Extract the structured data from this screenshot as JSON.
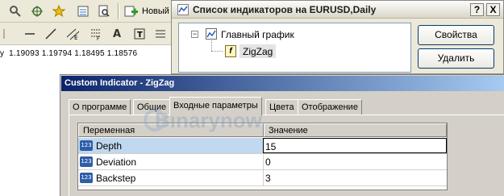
{
  "toolbar": {
    "new_order_label": "Новый о",
    "icons": [
      "magnifier-icon",
      "crosshair-icon",
      "star-icon",
      "new-chart-icon",
      "zoom-icon",
      "new-order-icon",
      "line-icon",
      "trendline-icon",
      "fibonacci-icon",
      "text-icon",
      "text-label-icon"
    ]
  },
  "price_line": "1.19093 1.19794 1.18495 1.18576",
  "price_prefix": "y",
  "indicator_window": {
    "title": "Список индикаторов на EURUSD,Daily",
    "help_button": "?",
    "close_button": "X",
    "tree": {
      "root_label": "Главный график",
      "child_label": "ZigZag",
      "expander": "−"
    },
    "buttons": {
      "properties": "Свойства",
      "delete": "Удалить"
    }
  },
  "custom_indicator_dialog": {
    "title": "Custom Indicator - ZigZag",
    "tabs": [
      "О программе",
      "Общие",
      "Входные параметры",
      "Цвета",
      "Отображение"
    ],
    "active_tab": 2,
    "table": {
      "headers": [
        "Переменная",
        "Значение"
      ],
      "rows": [
        {
          "name": "Depth",
          "value": "15"
        },
        {
          "name": "Deviation",
          "value": "0"
        },
        {
          "name": "Backstep",
          "value": "3"
        }
      ],
      "selected_row": 0,
      "param_icon": "123"
    },
    "watermark": "Binarynow"
  },
  "colors": {
    "dialog_title_start": "#0a246a",
    "dialog_title_end": "#a6caf0",
    "selected_row": "#c0d8f0",
    "param_icon": "#2d5ea8"
  }
}
